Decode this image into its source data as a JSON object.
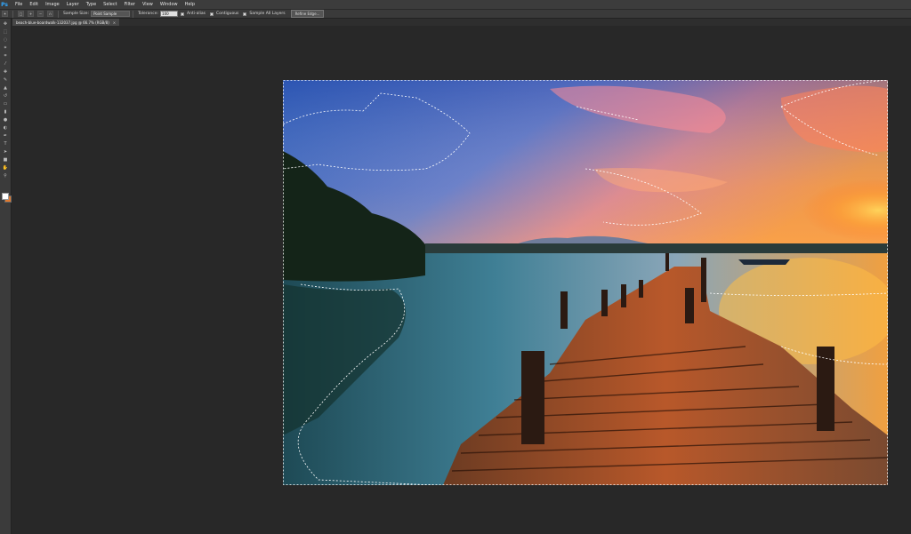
{
  "app": {
    "logo": "Ps",
    "menu": [
      "File",
      "Edit",
      "Image",
      "Layer",
      "Type",
      "Select",
      "Filter",
      "View",
      "Window",
      "Help"
    ]
  },
  "options": {
    "sample_size_label": "Sample Size:",
    "sample_size_value": "Point Sample",
    "tolerance_label": "Tolerance:",
    "tolerance_value": "100",
    "anti_alias_label": "Anti-alias",
    "contiguous_label": "Contiguous",
    "sample_all_layers_label": "Sample All Layers",
    "refine_edge_label": "Refine Edge..."
  },
  "document": {
    "tab_title": "beach-blue-boardwalk-132037.jpg @ 66.7% (RGB/8)",
    "close_glyph": "×"
  },
  "tools": [
    "move-icon",
    "marquee-icon",
    "lasso-icon",
    "magic-wand-icon",
    "crop-icon",
    "eyedropper-icon",
    "healing-icon",
    "brush-icon",
    "clone-stamp-icon",
    "history-brush-icon",
    "eraser-icon",
    "gradient-icon",
    "blur-icon",
    "dodge-icon",
    "pen-icon",
    "type-icon",
    "path-select-icon",
    "shape-icon",
    "hand-icon",
    "zoom-icon"
  ],
  "colors": {
    "foreground": "#ffffff",
    "background": "#e07a30",
    "workspace": "#282828"
  }
}
